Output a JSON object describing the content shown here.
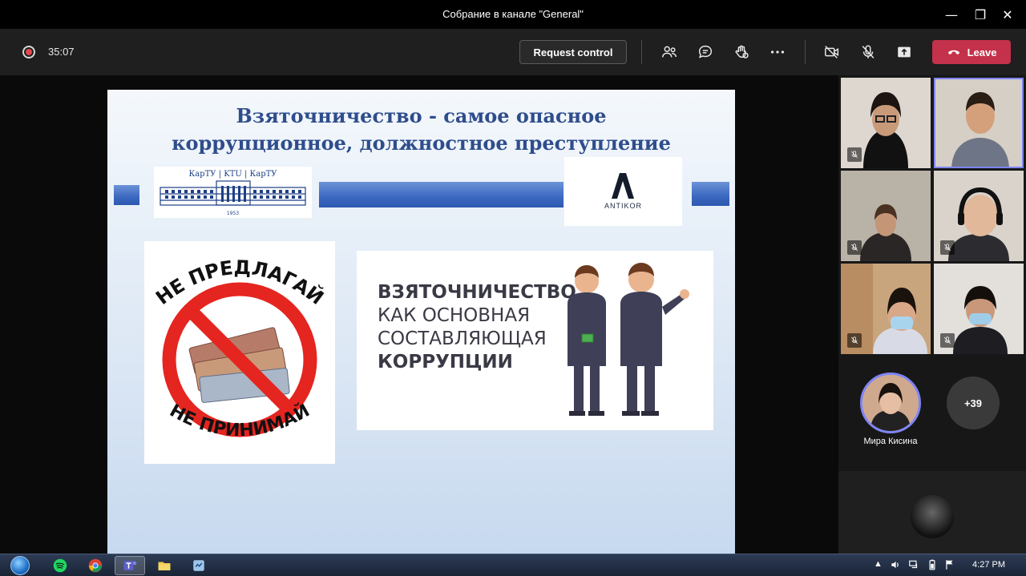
{
  "window": {
    "title": "Собрание в канале \"General\"",
    "minimize_glyph": "—",
    "restore_glyph": "❐",
    "close_glyph": "✕"
  },
  "toolbar": {
    "elapsed": "35:07",
    "request_control_label": "Request control",
    "leave_label": "Leave"
  },
  "slide": {
    "title_line1": "Взяточничество - самое опасное",
    "title_line2": "коррупционное, должностное преступление",
    "logo_kartu": "КарТУ  |  KTU  |  КарТУ",
    "logo_kartu_year": "1953",
    "logo_antikor": "ANTIKOR",
    "poster_left_top": "НЕ ПРЕДЛАГАЙ",
    "poster_left_bottom": "НЕ ПРИНИМАЙ",
    "poster_right": {
      "line1": "ВЗЯТОЧНИЧЕСТВО",
      "line2": "КАК ОСНОВНАЯ",
      "line3": "СОСТАВЛЯЮЩАЯ",
      "line4": "КОРРУПЦИИ"
    }
  },
  "participants": {
    "featured_name": "Мира Кисина",
    "overflow_count": "+39"
  },
  "taskbar": {
    "time": "4:27 PM"
  },
  "colors": {
    "leave": "#c4314b",
    "active_speaker": "#7f85f5",
    "slide_title": "#2e4d8c"
  }
}
